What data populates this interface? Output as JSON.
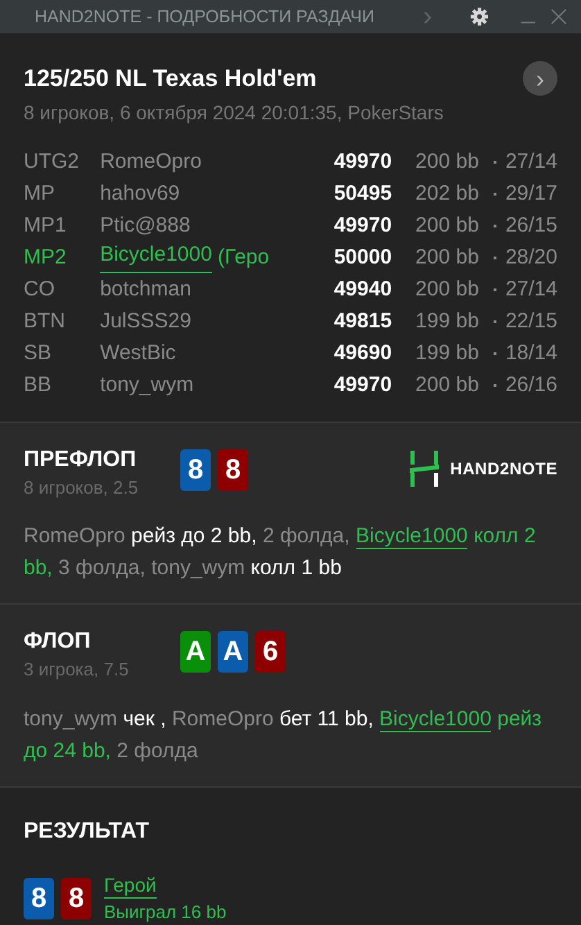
{
  "window": {
    "title": "HAND2NOTE - ПОДРОБНОСТИ РАЗДАЧИ",
    "chevron": "›"
  },
  "header": {
    "title": "125/250 NL Texas Hold'em",
    "subtitle": "8 игроков, 6 октября 2024 20:01:35, PokerStars"
  },
  "players": [
    {
      "position": "UTG2",
      "name": "RomeOpro",
      "stack": "49970",
      "bb": "200 bb",
      "stats": "27/14",
      "hero": false
    },
    {
      "position": "MP",
      "name": "hahov69",
      "stack": "50495",
      "bb": "202 bb",
      "stats": "29/17",
      "hero": false
    },
    {
      "position": "MP1",
      "name": "Ptic@888",
      "stack": "49970",
      "bb": "200 bb",
      "stats": "26/15",
      "hero": false
    },
    {
      "position": "MP2",
      "name": "Bicycle1000",
      "suffix": "(Геро",
      "stack": "50000",
      "bb": "200 bb",
      "stats": "28/20",
      "hero": true
    },
    {
      "position": "CO",
      "name": "botchman",
      "stack": "49940",
      "bb": "200 bb",
      "stats": "27/14",
      "hero": false
    },
    {
      "position": "BTN",
      "name": "JulSSS29",
      "stack": "49815",
      "bb": "199 bb",
      "stats": "22/15",
      "hero": false
    },
    {
      "position": "SB",
      "name": "WestBic",
      "stack": "49690",
      "bb": "199 bb",
      "stats": "18/14",
      "hero": false
    },
    {
      "position": "BB",
      "name": "tony_wym",
      "stack": "49970",
      "bb": "200 bb",
      "stats": "26/16",
      "hero": false
    }
  ],
  "streets": [
    {
      "title": "ПРЕФЛОП",
      "subtitle": "8 игроков, 2.5",
      "logo": {
        "text": "HAND2NOTE"
      },
      "cards": [
        {
          "rank": "8",
          "color": "#0b5cad"
        },
        {
          "rank": "8",
          "color": "#8e0000"
        }
      ],
      "actions": [
        {
          "kind": "player",
          "text": "RomeOpro"
        },
        {
          "kind": "action",
          "text": "рейз до 2 bb,"
        },
        {
          "kind": "text",
          "text": "2 фолда,"
        },
        {
          "kind": "hero",
          "text": "Bicycle1000"
        },
        {
          "kind": "hero-action",
          "text": "колл 2 bb,"
        },
        {
          "kind": "text",
          "text": "3 фолда,"
        },
        {
          "kind": "player",
          "text": "tony_wym"
        },
        {
          "kind": "action",
          "text": "колл 1 bb"
        }
      ]
    },
    {
      "title": "ФЛОП",
      "subtitle": "3 игрока, 7.5",
      "cards": [
        {
          "rank": "A",
          "color": "#0a8f0a"
        },
        {
          "rank": "A",
          "color": "#0b5cad"
        },
        {
          "rank": "6",
          "color": "#8e0000"
        }
      ],
      "actions": [
        {
          "kind": "player",
          "text": "tony_wym"
        },
        {
          "kind": "action",
          "text": "чек ,"
        },
        {
          "kind": "player",
          "text": "RomeOpro"
        },
        {
          "kind": "action",
          "text": "бет 11 bb,"
        },
        {
          "kind": "hero",
          "text": "Bicycle1000"
        },
        {
          "kind": "hero-action",
          "text": "рейз до 24 bb,"
        },
        {
          "kind": "text",
          "text": "2 фолда"
        }
      ]
    }
  ],
  "result": {
    "title": "РЕЗУЛЬТАТ",
    "cards": [
      {
        "rank": "8",
        "color": "#0b5cad"
      },
      {
        "rank": "8",
        "color": "#8e0000"
      }
    ],
    "player": "Герой",
    "outcome": "Выиграл 16 bb"
  }
}
